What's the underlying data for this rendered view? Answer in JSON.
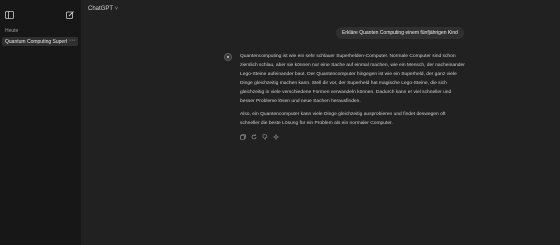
{
  "sidebar": {
    "section_label": "Heute",
    "history": [
      {
        "label": "Quantum Computing Superh",
        "more": "⋯"
      }
    ],
    "toggle_icon": "sidebar-toggle-icon",
    "new_chat_icon": "new-chat-icon"
  },
  "header": {
    "model": "ChatGPT",
    "chevron": "˅"
  },
  "conversation": {
    "user_message": "Erkläre Quanten Computing einem fünfjährigen Kind",
    "assistant_paragraphs": [
      "Quantencomputing ist wie ein sehr schlauer Superhelden-Computer. Normale Computer sind schon ziemlich schlau, aber sie können nur eine Sache auf einmal machen, wie ein Mensch, der nacheinander Lego-Steine aufeinander baut. Der Quantencomputer hingegen ist wie ein Superheld, der ganz viele Dinge gleichzeitig machen kann. Stell dir vor, der Superheld hat magische Lego-Steine, die sich gleichzeitig in viele verschiedene Formen verwandeln können. Dadurch kann er viel schneller und besser Probleme lösen und neue Sachen herausfinden.",
      "Also, ein Quantencomputer kann viele Dinge gleichzeitig ausprobieren und findet deswegen oft schneller die beste Lösung für ein Problem als ein normaler Computer."
    ],
    "actions": [
      "copy-icon",
      "regenerate-icon",
      "thumbs-down-icon",
      "sparkle-icon"
    ]
  }
}
